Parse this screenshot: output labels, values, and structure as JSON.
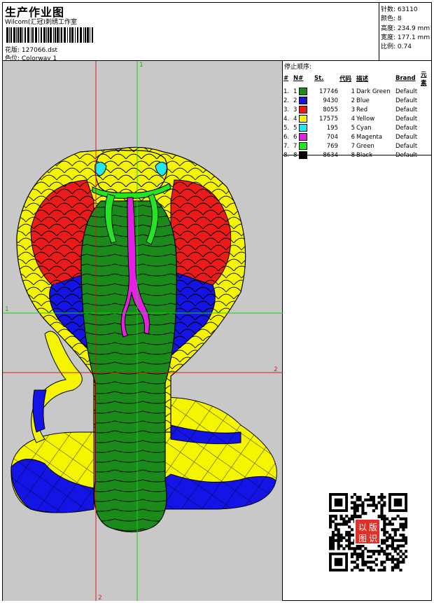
{
  "header": {
    "title": "生产作业图",
    "subtitle": "Wilcom(汇冠)刺绣工作室",
    "pattern_label": "花版:",
    "pattern_value": "127066.dst",
    "colorway_label": "色位:",
    "colorway_value": "Colorway 1"
  },
  "stats": [
    {
      "label": "针数:",
      "value": "63110"
    },
    {
      "label": "颜色:",
      "value": "8"
    },
    {
      "label": "高度:",
      "value": "234.9 mm"
    },
    {
      "label": "宽度:",
      "value": "177.1 mm"
    },
    {
      "label": "比例:",
      "value": "0.74"
    }
  ],
  "stop_sequence": {
    "title": "停止顺序:",
    "columns": [
      "#",
      "N#",
      "St.",
      "代码",
      "描述",
      "Brand",
      "元素"
    ],
    "rows": [
      {
        "num": "1.",
        "n": "1",
        "color": "#1a8a1a",
        "st": "17746",
        "code": "1",
        "desc": "Dark Green",
        "brand": "Default"
      },
      {
        "num": "2.",
        "n": "2",
        "color": "#1414e6",
        "st": "9430",
        "code": "2",
        "desc": "Blue",
        "brand": "Default"
      },
      {
        "num": "3.",
        "n": "3",
        "color": "#ee1a1a",
        "st": "8055",
        "code": "3",
        "desc": "Red",
        "brand": "Default"
      },
      {
        "num": "4.",
        "n": "4",
        "color": "#f5f500",
        "st": "17575",
        "code": "4",
        "desc": "Yellow",
        "brand": "Default"
      },
      {
        "num": "5.",
        "n": "5",
        "color": "#22e6f0",
        "st": "195",
        "code": "5",
        "desc": "Cyan",
        "brand": "Default"
      },
      {
        "num": "6.",
        "n": "6",
        "color": "#e61ee6",
        "st": "704",
        "code": "6",
        "desc": "Magenta",
        "brand": "Default"
      },
      {
        "num": "7.",
        "n": "7",
        "color": "#22e622",
        "st": "769",
        "code": "7",
        "desc": "Green",
        "brand": "Default"
      },
      {
        "num": "8.",
        "n": "8",
        "color": "#000000",
        "st": "8634",
        "code": "8",
        "desc": "Black",
        "brand": "Default"
      }
    ]
  },
  "guides": {
    "label_top": "1",
    "label_left": "1",
    "label_right": "2",
    "label_bottom": "2"
  },
  "stamp": {
    "chars": [
      "以",
      "版",
      "图",
      "识"
    ],
    "color": "#e0302a"
  },
  "icons": {
    "qr": "qr-code-icon",
    "barcode": "barcode-icon"
  }
}
